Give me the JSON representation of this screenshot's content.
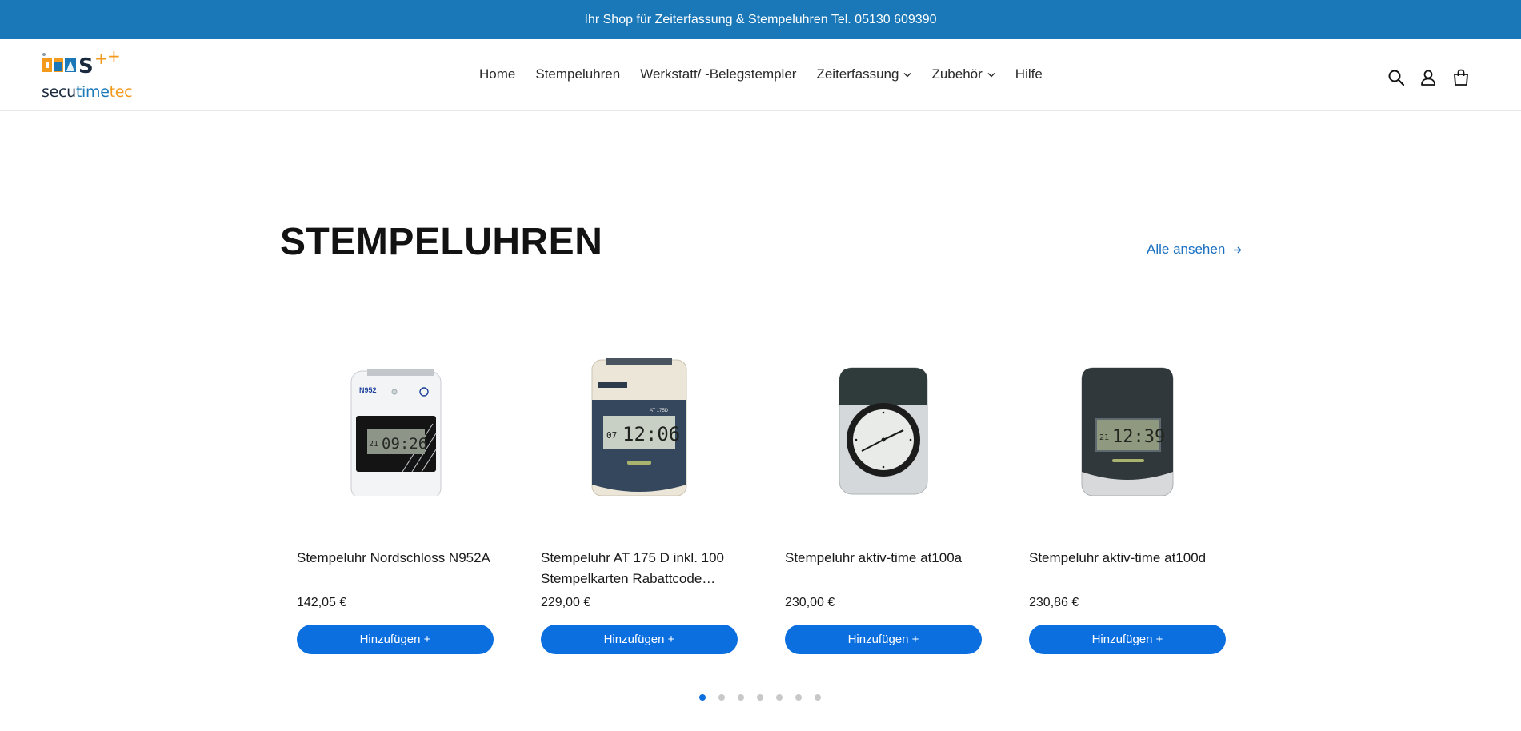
{
  "announcement": {
    "text": "Ihr Shop für Zeiterfassung & Stempeluhren Tel. 05130 609390"
  },
  "header": {
    "logo": {
      "word_part1": "secu",
      "word_part2": "time",
      "word_part3": "tec",
      "mark_text": "S++"
    },
    "nav": [
      {
        "label": "Home",
        "active": true
      },
      {
        "label": "Stempeluhren"
      },
      {
        "label": "Werkstatt/ -Belegstempler"
      },
      {
        "label": "Zeiterfassung",
        "dropdown": true
      },
      {
        "label": "Zubehör",
        "dropdown": true
      },
      {
        "label": "Hilfe"
      }
    ],
    "icons": [
      "search-icon",
      "account-icon",
      "cart-icon"
    ]
  },
  "section": {
    "title": "STEMPELUHREN",
    "view_all": "Alle ansehen"
  },
  "products": [
    {
      "title": "Stempeluhr Nordschloss N952A",
      "price": "142,05 €",
      "button": "Hinzufügen +",
      "display": {
        "day": "21",
        "time": "09:26",
        "model": "N952"
      }
    },
    {
      "title": "Stempeluhr AT 175 D inkl. 100 Stempelkarten Rabattcode…",
      "price": "229,00 €",
      "button": "Hinzufügen +",
      "display": {
        "day": "07",
        "time": "12:06",
        "model": "AT 175D"
      }
    },
    {
      "title": "Stempeluhr aktiv-time at100a",
      "price": "230,00 €",
      "button": "Hinzufügen +"
    },
    {
      "title": "Stempeluhr aktiv-time at100d",
      "price": "230,86 €",
      "button": "Hinzufügen +",
      "display": {
        "day": "21",
        "time": "12:39"
      }
    }
  ],
  "pagination": {
    "count": 7,
    "active_index": 0
  },
  "colors": {
    "announcement_bg": "#1a78b8",
    "button": "#0b6fe0",
    "link": "#1a6fc1",
    "logo_orange": "#f39a1c",
    "logo_blue": "#1a78b8"
  }
}
